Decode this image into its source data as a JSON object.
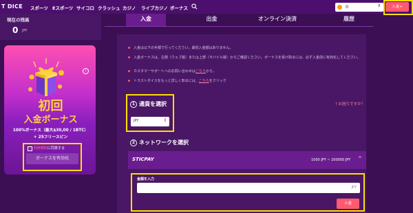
{
  "nav": {
    "logo": "T DICE",
    "links": [
      "スポーツ",
      "Eスポーツ",
      "サイコロ",
      "クラッシュ",
      "カジノ",
      "ライブカジノ",
      "ボーナス"
    ],
    "wallet_value": "0",
    "deposit_label": "入金+"
  },
  "balance": {
    "label": "現在の残高",
    "value": "0",
    "unit": "JPY"
  },
  "bonus": {
    "title1": "初回",
    "title2": "入金ボーナス",
    "line1": "100%ボーナス（最大$30,00 / 1BTC）",
    "line2": "+ 25フリースピン",
    "checkbox_link": "利用規約",
    "checkbox_suffix": "に同意する",
    "activate_label": "ボーナスを有効化"
  },
  "tabs": [
    "入金",
    "出金",
    "オンライン決済",
    "履歴"
  ],
  "notes": [
    {
      "text": "入金は以下の手順で行ってください。最低入金額はありません。"
    },
    {
      "text": "入金ボーナスは、左側（ウェブ版）または上部（モバイル版）からご確認ください。ボーナスを受け取るには、必ず入金前に有効化してください。"
    },
    {
      "pre": "カスタマーサポートへのお問い合わせは",
      "link": "こちら",
      "post": "から。"
    },
    {
      "pre": "トラストダイスをもっと詳しく知るには、",
      "link": "こちら",
      "post": "をクリック"
    }
  ],
  "step1": {
    "number": "1",
    "title": "通貨を選択",
    "help": "お困りですか？",
    "currency": "JPY"
  },
  "step2": {
    "number": "2",
    "title": "ネットワークを選択"
  },
  "payment": {
    "method": "STICPAY",
    "range": "1000 JPY ~ 200000 JPY"
  },
  "amount": {
    "label": "金額を入力",
    "unit": "JPY",
    "submit_label": "入金"
  },
  "colors": {
    "background": "#3c0f55",
    "accent": "#ff5a6e",
    "highlight": "#ffe100",
    "gold": "#ffd23c"
  }
}
